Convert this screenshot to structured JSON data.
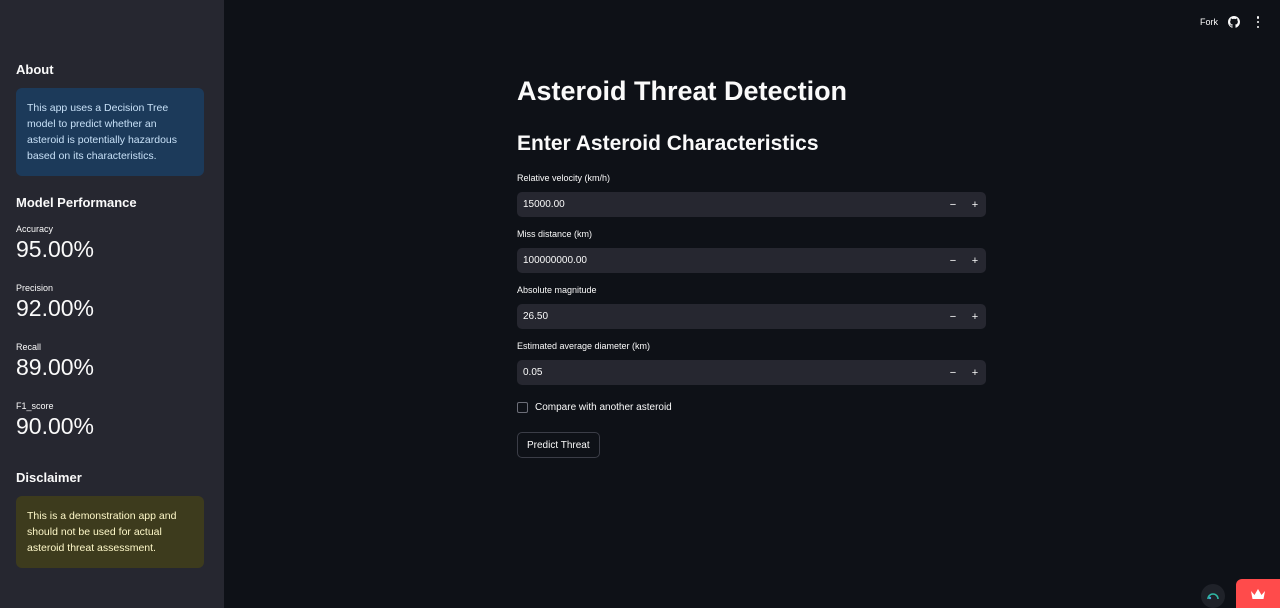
{
  "sidebar": {
    "about_heading": "About",
    "about_text": "This app uses a Decision Tree model to predict whether an asteroid is potentially hazardous based on its characteristics.",
    "performance_heading": "Model Performance",
    "metrics": [
      {
        "label": "Accuracy",
        "value": "95.00%"
      },
      {
        "label": "Precision",
        "value": "92.00%"
      },
      {
        "label": "Recall",
        "value": "89.00%"
      },
      {
        "label": "F1_score",
        "value": "90.00%"
      }
    ],
    "disclaimer_heading": "Disclaimer",
    "disclaimer_text": "This is a demonstration app and should not be used for actual asteroid threat assessment."
  },
  "topbar": {
    "fork_label": "Fork",
    "github_icon": "github-icon",
    "menu_icon": "kebab-menu-icon"
  },
  "main": {
    "title": "Asteroid Threat Detection",
    "subtitle": "Enter Asteroid Characteristics",
    "fields": [
      {
        "label": "Relative velocity (km/h)",
        "value": "15000.00"
      },
      {
        "label": "Miss distance (km)",
        "value": "100000000.00"
      },
      {
        "label": "Absolute magnitude",
        "value": "26.50"
      },
      {
        "label": "Estimated average diameter (km)",
        "value": "0.05"
      }
    ],
    "stepper_minus": "−",
    "stepper_plus": "+",
    "compare_label": "Compare with another asteroid",
    "compare_checked": false,
    "predict_label": "Predict Threat"
  },
  "colors": {
    "background": "#0e1117",
    "sidebar": "#262730",
    "info": "#1c3a5a",
    "warning": "#3d3b1d",
    "accent": "#ff4b4b"
  }
}
